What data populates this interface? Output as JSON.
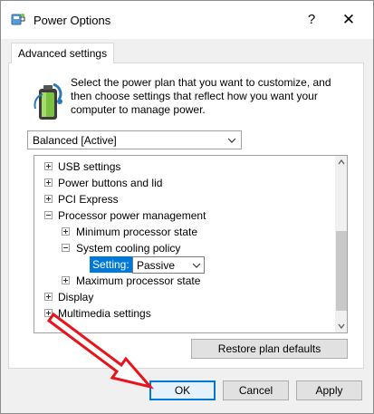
{
  "window": {
    "title": "Power Options",
    "help_symbol": "?",
    "close_symbol": "✕",
    "icon": "power-options-icon"
  },
  "tabs": [
    {
      "label": "Advanced settings",
      "selected": true
    }
  ],
  "description": "Select the power plan that you want to customize, and then choose settings that reflect how you want your computer to manage power.",
  "plan_select": {
    "value": "Balanced [Active]"
  },
  "tree": {
    "items": [
      {
        "label": "USB settings",
        "expander": "plus",
        "level": 0
      },
      {
        "label": "Power buttons and lid",
        "expander": "plus",
        "level": 0
      },
      {
        "label": "PCI Express",
        "expander": "plus",
        "level": 0
      },
      {
        "label": "Processor power management",
        "expander": "minus",
        "level": 0
      },
      {
        "label": "Minimum processor state",
        "expander": "plus",
        "level": 1
      },
      {
        "label": "System cooling policy",
        "expander": "minus",
        "level": 1
      },
      {
        "label": "Maximum processor state",
        "expander": "plus",
        "level": 1
      },
      {
        "label": "Display",
        "expander": "plus",
        "level": 0
      },
      {
        "label": "Multimedia settings",
        "expander": "plus",
        "level": 0
      }
    ],
    "setting": {
      "label": "Setting:",
      "value": "Passive"
    }
  },
  "buttons": {
    "restore": "Restore plan defaults",
    "ok": "OK",
    "cancel": "Cancel",
    "apply": "Apply"
  },
  "colors": {
    "accent": "#0078d7",
    "annotation_arrow": "#e8141a",
    "dialog_background": "#f0f0f0"
  }
}
